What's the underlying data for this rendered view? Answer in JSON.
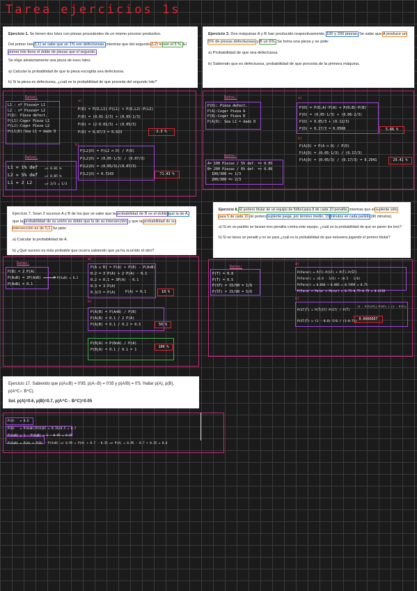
{
  "page_title": "Tarea ejercicios 1s",
  "ex1": {
    "heading": "Ejercicio 1.",
    "intro": "Se tienen dos lotes con piezas procedentes de un mismo proceso productivo.",
    "l2a": "Del primer lote",
    "h1": "(L1) se sabe que un 1% son defectuosas,",
    "l2b": "mientras que del segundo",
    "h2": "(L2) lo",
    "h3": "son el 5 %.",
    "l3b": "El",
    "h4": "primer lote tiene el doble de piezas que el segundo.",
    "l4": "Se elige aleatoriamente una pieza de esos lotes:",
    "qa": "a) Calcular la probabilidad de que la pieza escogida sea defectuosa.",
    "qb": "b) Si la pieza es defectuosa, ¿cuál es la probabilidad de que proceda del segundo lote?"
  },
  "ex3": {
    "heading": "Ejercicio 3.",
    "t1": "Dos máquinas A y B han producido respectivamente,",
    "h1": "100 y 200 piezas.",
    "t2": "Se",
    "t3": "sabe que",
    "h2": "A produce un 5% de piezas defectuosas",
    "t4": "y",
    "h3": "B un 6%.",
    "t5": "Se toma una pieza y se pide:",
    "qa": "a) Probabilidad de que sea defectuosa.",
    "qb": "b) Sabiendo que es defectuosa, probabilidad de que proceda de la primera máquina."
  },
  "ex7": {
    "t1": "Ejercicio 7. Sean 2 sucesos A y B de los que se sabe que la",
    "h1": "probabilidad de B es el doble",
    "h2": "que la de A,",
    "t2": "que la",
    "h3": "probabilidad de su unión es doble que la de su intersección;",
    "t3": "y que la",
    "h4": "probabilidad de su intersección es de 0,1.",
    "t4": "Se pide:",
    "qa": "a) Calcular la probabilidad de A.",
    "qb": "b) ¿Qué suceso es más probable que ocurra sabiendo que ya ha ocurrido el otro?"
  },
  "ex8": {
    "heading": "Ejercicio 8.",
    "h1": "El portero titular de un equipo de fútbol para 8 de cada 10 penaltis,",
    "t1": "mientras",
    "t2": "que el",
    "h2": "suplente sólo para 5 de cada 10.",
    "t3": "El portero",
    "h3": "suplente juega, por término medio, 15",
    "h4": "minutos en cada partido",
    "t4": "(90 minutos).",
    "qa": "a) Si en un partido se lanzan tres penaltis contra este equipo, ¿cuál es la probabilidad de que se paren los tres?",
    "qb": "b) Si se lanza un penalti y no se para ¿cuál es la probabilidad de que estuviera jugando el portero titular?"
  },
  "ex17": {
    "t1": "Ejercicio 17. Sabiendo que p(A∪B) = 0'95; p(A∩B) = 0'35 y p(A/B) = 0'5. Hallar p(A), p(B),",
    "t2": "p(A^C∩ B^C).",
    "sol": "Sol. p(A)=0.6, p(B)=0.7, p(A^C∩ B^C)=0.05"
  },
  "hw1": {
    "datos": "Datos:",
    "left": "L1 : nº Piezas= L1\nL2 : nº Piezas= L2\nP(D): Pieza defect.\nP(L1):Coger Pieza L1\nP(L2):Coger Pieza L2\nP(L1|D):Sea L1 = dado D",
    "datos2": "Datos:",
    "left2": "L1 = 1% def\nL2 = 5% def\nL1 = 2 L2",
    "left2b": "=> 0.01 %\n=> 0.05 %\n=> 2/3 = 1/3",
    "a_label": "a)",
    "a": "P(D) = P(D,L1)·P(L1) + P(D,L2)·P(L2)\nP(D) = (0.01·2/3) + (0.05·1/3)\nP(D) = (2·0.01/3) + (0.05/3)\nP(D) = 0.07/3 = 0.023",
    "a_ans": "2.3 %",
    "b_label": "b)",
    "b": "P(L2|D) = P(L2 ∩ D) / P(D)\nP(L2|D) = (0.05·1/3) / (0.07/3)\nP(L2|D) = (0.05/3)/(0.07/3)\nP(L2|D) = 0.7143",
    "b_ans": "71.43 %"
  },
  "hw3": {
    "datos": "Datos:",
    "left": "P(D): Pieza defect.\nP(A):Coger Pieza A\nP(B):Coger Pieza B\nP(A|D): Sea L1 = dado D",
    "datos2": "Datos:",
    "left2": "A= 100 Piezas / 5% def. => 0.05\nB= 200 Piezas / 6% def. => 0.06\n  100/300 => 1/3\n  200/300 => 2/3",
    "a_label": "a)",
    "a": "P(D) = P(D,A)·P(A) + P(D,B)·P(B)\nP(D) = (0.05·1/3) + (0.06·2/3)\nP(D) = 0.05/3 + (0.12/3)\nP(D) = 0.17/3 = 0.0566",
    "a_ans": "5.66 %",
    "b_label": "b)",
    "b": "P(A|D) = P(A ∩ D) / P(D)\nP(A|D) = (0.05·1/3) / (0.17/3)\nP(A|D) = (0.05/3) / (0.17/3) = 0.2941",
    "b_ans": "29.41 %"
  },
  "hw7": {
    "datos": "Datos:",
    "left": "P(B) = 2 P(A)\nP(A∪B) = 2P(A∩B)\nP(A∩B) = 0.1",
    "left_side": "P(A∪B) = 0.2",
    "a_label": "a)",
    "a": "P(A ∪ B) = P(A) + P(B) - P(A∩B)\n0.2 = 3 P(A) + 2 P(A) - 0.1\n0.2 + 0.1 = 3P(A) - 0.1\n0.3 = 3 P(A)\n0.3/3 = P(A)",
    "a_res": "P(A) = 0.1",
    "a_ans": "10 %",
    "b_label": "b)",
    "b": "P(A|B) = P(A∩B) / P(B)\nP(A|B) = 0.1 / 2 P(A)\nP(A|B) = 0.1 / 0.2 = 0.5",
    "b_ans": "50 %",
    "c": "P(B|A) = P(B∩A) / P(A)\nP(B|A) = 0.1 / 0.1 = 1",
    "c_ans": "100 %"
  },
  "hw8": {
    "datos": "Datos:",
    "left": "P(T) = 0.8\nP(T̄) = 0.5\nP(ST) = 15/90 = 1/6\nP(S̄T) = 15/90 = 5/6",
    "a_label": "a)",
    "a": "P(Parar) = P(T)·P(ST) + P(T̄)·P(S̄T)\nP(Parar) = (0.8 · 5/6) + (0.5 · 1/6)\nP(Parar) = 0.666 + 0.083 = 0.7499 = 0.75\nP(Parar ∩ Parar ∩ Parar) = 0.75·0.75·0.75 = 0.4218",
    "b_label": "b)",
    "b": "P(ST|T̄) = P(T̄|ST)·P(ST) / P(T̄)\nP(ST|T̄) = (1 - 0.8)·5/6 / (1-0.75)",
    "b_right": "(1 - P(T|ST))·P(ST) / (1 - P(T))",
    "b_ans": "0.6666667"
  },
  "hw17": {
    "lines": "P(A)   = 0.6\nP(B)   = P(A∩B)/P(A|B) = 0.35/0.5 = 0.7\nP(A∩B) = 1 - P(A∪B) = 1 - 0.95 = 0.05\nP(A∪B) = P(A) + P(B) - P(A∩B) => 0.95 = P(A) + 0.7 - 0.35 => P(A) = 0.95 - 0.7 + 0.35 = 0.6"
  }
}
